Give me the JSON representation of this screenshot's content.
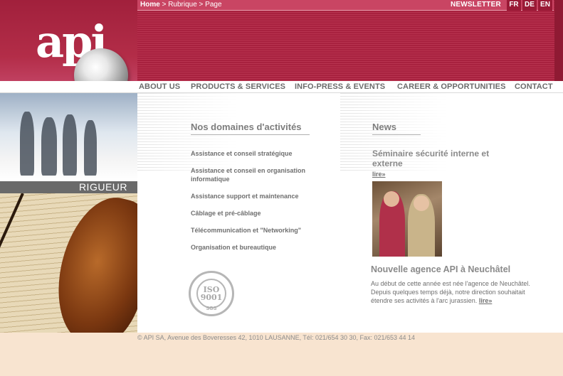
{
  "topbar": {
    "breadcrumb_home": "Home",
    "breadcrumb_rest": " > Rubrique > Page",
    "newsletter": "NEWSLETTER",
    "languages": [
      "FR",
      "DE",
      "EN"
    ]
  },
  "logo": {
    "text": "api"
  },
  "nav": [
    "ABOUT US",
    "PRODUCTS & SERVICES",
    "INFO-PRESS & EVENTS",
    "CAREER & OPPORTUNITIES",
    "CONTACT"
  ],
  "left": {
    "caption": "RIGUEUR"
  },
  "domains": {
    "title": "Nos domaines d'activités",
    "items": [
      "Assistance et conseil stratégique",
      "Assistance et conseil en organisation informatique",
      "Assistance support et maintenance",
      "Câblage et pré-câblage",
      "Télécommunication et \"Networking\"",
      "Organisation et bureautique"
    ]
  },
  "iso": {
    "line1": "ISO",
    "line2": "9001",
    "badge": "SGS"
  },
  "news": {
    "title": "News",
    "item1_title": "Séminaire sécurité interne et externe",
    "item1_link": "lire»",
    "item2_title": "Nouvelle agence API à Neuchâtel",
    "item2_body": "Au début de cette année est née l'agence de Neuchâtel. Depuis quelques temps déjà, notre direction souhaitait étendre ses activités à l'arc jurassien.",
    "item2_link": "lire»"
  },
  "footer": "© API SA, Avenue des Boveresses 42, 1010 LAUSANNE, Tél: 021/654 30 30, Fax: 021/653 44 14",
  "colors": {
    "brand": "#a8213f",
    "nav_text": "#6b6b6b",
    "footer_bg": "#f8e4d0"
  }
}
